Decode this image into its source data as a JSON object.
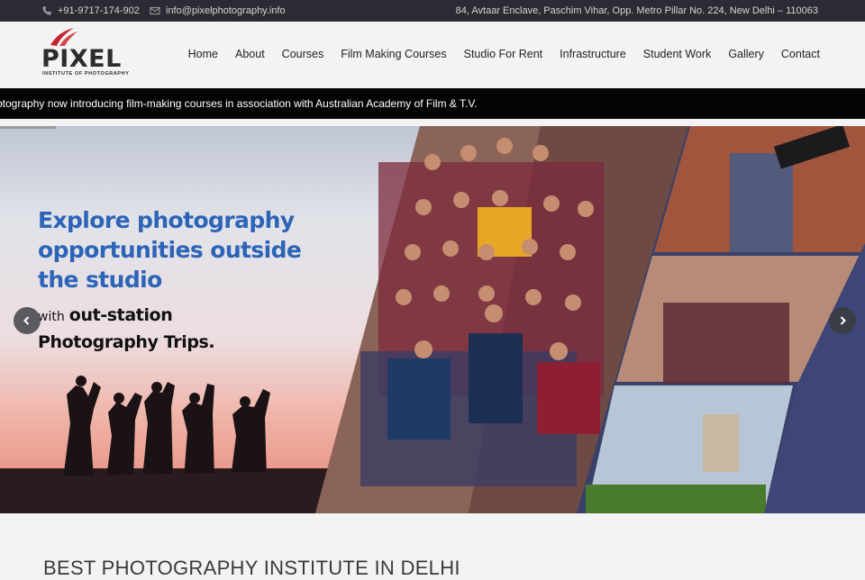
{
  "topbar": {
    "phone": "+91-9717-174-902",
    "email": "info@pixelphotography.info",
    "address": "84, Avtaar Enclave, Paschim Vihar, Opp. Metro Pillar No. 224, New Delhi – 110063"
  },
  "logo": {
    "name": "PIXEL",
    "tagline": "INSTITUTE OF PHOTOGRAPHY",
    "accent_color": "#c8232c"
  },
  "nav": {
    "items": [
      "Home",
      "About",
      "Courses",
      "Film Making Courses",
      "Studio For Rent",
      "Infrastructure",
      "Student Work",
      "Gallery",
      "Contact"
    ]
  },
  "ticker": {
    "text": "otography now introducing film-making courses in association with Australian Academy of Film & T.V."
  },
  "hero": {
    "headline": [
      "Explore photography",
      "opportunities outside",
      "the studio"
    ],
    "sub_prefix": "with",
    "sub_bold_1": "out-station",
    "sub_bold_2": "Photography Trips.",
    "headline_color": "#2c64b8",
    "prev_icon": "chevron-left-icon",
    "next_icon": "chevron-right-icon"
  },
  "section": {
    "title": "BEST PHOTOGRAPHY INSTITUTE IN DELHI"
  }
}
